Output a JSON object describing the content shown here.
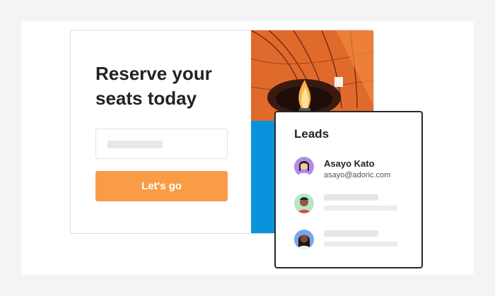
{
  "hero": {
    "headline": "Reserve your seats today",
    "email_input": {
      "value": "",
      "placeholder": ""
    },
    "cta_label": "Let's go"
  },
  "leads_panel": {
    "title": "Leads",
    "items": [
      {
        "name": "Asayo Kato",
        "email": "asayo@adoric.com",
        "avatar_bg": "#b48ae6"
      },
      {
        "name": "",
        "email": "",
        "avatar_bg": "#b8e6c2"
      },
      {
        "name": "",
        "email": "",
        "avatar_bg": "#7aa6e8"
      }
    ]
  },
  "colors": {
    "cta": "#f99c45",
    "photo_bg": "#0a93dc",
    "balloon": "#e2622a"
  }
}
